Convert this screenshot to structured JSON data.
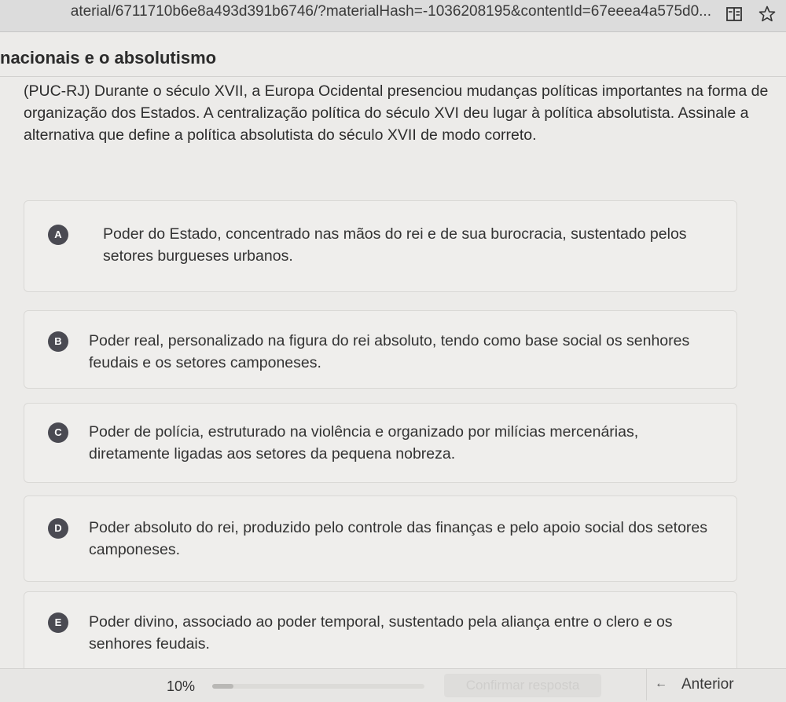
{
  "browser": {
    "url": "aterial/6711710b6e8a493d391b6746/?materialHash=-1036208195&contentId=67eeea4a575d0..."
  },
  "lesson": {
    "title": "nacionais e o absolutismo"
  },
  "question": {
    "text": "(PUC-RJ) Durante o século XVII, a Europa Ocidental presenciou mudanças políticas importantes na forma de organização dos Estados. A centralização política do século XVI deu lugar à política absolutista. Assinale a alternativa que define a política absolutista do século XVII de modo correto."
  },
  "options": [
    {
      "letter": "A",
      "text": "Poder do Estado, concentrado nas mãos do rei e de sua burocracia, sustentado pelos setores burgueses urbanos."
    },
    {
      "letter": "B",
      "text": "Poder real, personalizado na figura do rei absoluto, tendo como base social os senhores feudais e os setores camponeses."
    },
    {
      "letter": "C",
      "text": "Poder de polícia, estruturado na violência e organizado por milícias mercenárias, diretamente ligadas aos setores da pequena nobreza."
    },
    {
      "letter": "D",
      "text": "Poder absoluto do rei, produzido pelo controle das finanças e pelo apoio social dos setores camponeses."
    },
    {
      "letter": "E",
      "text": "Poder divino, associado ao poder temporal, sustentado pela aliança entre o clero e os senhores feudais."
    }
  ],
  "footer": {
    "progress_label": "10%",
    "progress_fraction": 0.1,
    "confirm_label": "Confirmar resposta",
    "prev_arrow": "←",
    "prev_label": "Anterior"
  },
  "colors": {
    "badge": "#4a4a52",
    "page_background": "#ecebe9"
  },
  "icons": [
    "reader-mode-icon",
    "bookmark-star-icon",
    "arrow-left-icon"
  ]
}
